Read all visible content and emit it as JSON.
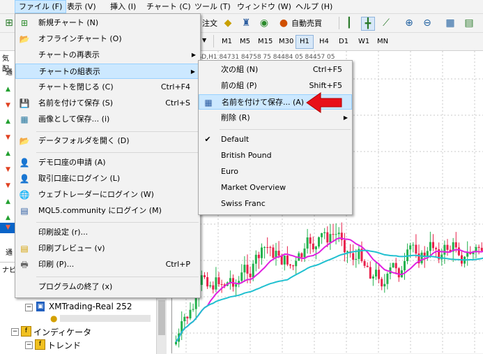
{
  "menubar": [
    {
      "label": "ファイル (F)",
      "active": true
    },
    {
      "label": "表示 (V)"
    },
    {
      "label": "挿入 (I)"
    },
    {
      "label": "チャート (C)"
    },
    {
      "label": "ツール (T)"
    },
    {
      "label": "ウィンドウ (W)"
    },
    {
      "label": "ヘルプ (H)"
    }
  ],
  "toolbar": {
    "order_label": "注文",
    "auto_trade_label": "自動売買",
    "timeframes": [
      "M1",
      "M5",
      "M15",
      "M30",
      "H1",
      "H4",
      "D1",
      "W1",
      "MN"
    ],
    "selected_timeframe": "H1",
    "symbol_partial": "USD,H1  84731 84758 75 84484 05 84457 05"
  },
  "left_panel": {
    "header": "気配",
    "tab": "通"
  },
  "file_menu": {
    "items": [
      {
        "label": "新規チャート (N)",
        "shortcut": "",
        "icon": "new-chart-icon"
      },
      {
        "label": "オフラインチャート (O)",
        "shortcut": "",
        "icon": "folder-icon"
      },
      {
        "label": "チャートの再表示",
        "shortcut": "",
        "submenu": true
      },
      {
        "label": "チャートの組表示",
        "shortcut": "",
        "submenu": true,
        "highlighted": true
      },
      {
        "label": "チャートを閉じる (C)",
        "shortcut": "Ctrl+F4"
      },
      {
        "label": "名前を付けて保存 (S)",
        "shortcut": "Ctrl+S",
        "icon": "save-icon"
      },
      {
        "label": "画像として保存... (i)",
        "shortcut": "",
        "icon": "save-image-icon"
      },
      {
        "label": "データフォルダを開く (D)",
        "shortcut": "",
        "icon": "folder-open-icon"
      },
      {
        "label": "デモ口座の申請 (A)",
        "shortcut": "",
        "icon": "demo-account-icon"
      },
      {
        "label": "取引口座にログイン (L)",
        "shortcut": "",
        "icon": "login-icon"
      },
      {
        "label": "ウェブトレーダーにログイン (W)",
        "shortcut": "",
        "icon": "web-trader-icon"
      },
      {
        "label": "MQL5.community にログイン (M)",
        "shortcut": "",
        "icon": "mql5-icon"
      },
      {
        "label": "印刷設定 (r)...",
        "shortcut": ""
      },
      {
        "label": "印刷プレビュー (v)",
        "shortcut": "",
        "icon": "print-preview-icon"
      },
      {
        "label": "印刷 (P)...",
        "shortcut": "Ctrl+P",
        "icon": "print-icon"
      },
      {
        "label": "プログラムの終了 (x)",
        "shortcut": ""
      }
    ]
  },
  "profiles_menu": {
    "items": [
      {
        "label": "次の組 (N)",
        "shortcut": "Ctrl+F5"
      },
      {
        "label": "前の組 (P)",
        "shortcut": "Shift+F5"
      },
      {
        "label": "名前を付けて保存... (A)",
        "shortcut": "",
        "highlighted": true,
        "icon": "save-profile-icon"
      },
      {
        "label": "削除 (R)",
        "shortcut": "",
        "submenu": true
      },
      {
        "label": "Default",
        "checked": true
      },
      {
        "label": "British Pound"
      },
      {
        "label": "Euro"
      },
      {
        "label": "Market Overview"
      },
      {
        "label": "Swiss Franc"
      }
    ]
  },
  "navigator": {
    "header": "ナビ",
    "account_label": "XMTrading-Real 252",
    "indicators_label": "インディケータ",
    "trend_label": "トレンド"
  },
  "colors": {
    "highlight": "#cce8ff",
    "highlight_border": "#99d1ff",
    "candle_up": "#22b14c",
    "candle_down": "#e8204a",
    "ma_fast": "#e020e0",
    "ma_slow": "#20c0d0",
    "pointer_arrow": "#e8101a"
  }
}
